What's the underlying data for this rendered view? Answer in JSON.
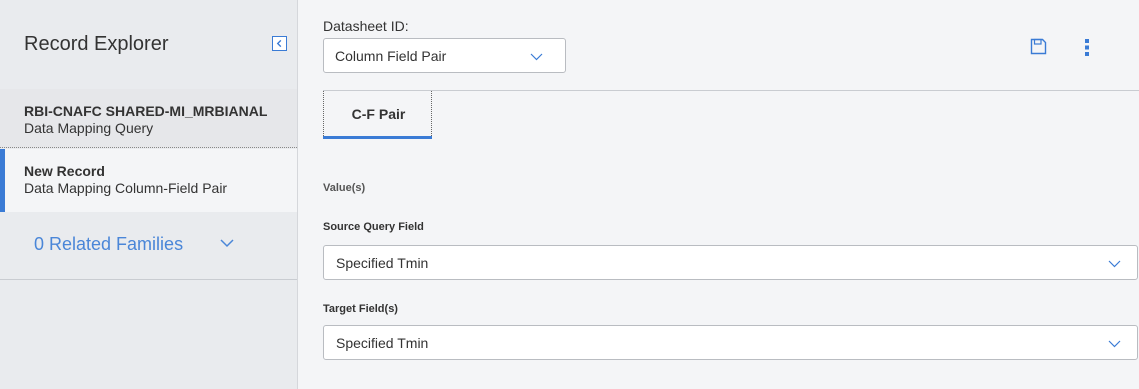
{
  "left_panel": {
    "title": "Record Explorer",
    "records": [
      {
        "title": "RBI-CNAFC SHARED-MI_MRBIANAL",
        "subtitle": "Data Mapping Query"
      },
      {
        "title": "New Record",
        "subtitle": "Data Mapping Column-Field Pair"
      }
    ],
    "related_families": "0 Related Families"
  },
  "main": {
    "datasheet_label": "Datasheet ID:",
    "datasheet_value": "Column Field Pair",
    "tab_label": "C-F Pair",
    "values_label": "Value(s)",
    "source_query_field_label": "Source Query Field",
    "source_query_field_value": "Specified Tmin",
    "target_fields_label": "Target Field(s)",
    "target_fields_value": "Specified Tmin"
  },
  "colors": {
    "accent": "#3a7bd5",
    "link": "#4a86d8",
    "panel_bg": "#e9ebee",
    "content_bg": "#f4f5f7"
  },
  "icons": {
    "collapse": "chevron-left-icon",
    "save": "save-icon",
    "more": "more-vertical-icon",
    "dropdown": "chevron-down-icon"
  }
}
